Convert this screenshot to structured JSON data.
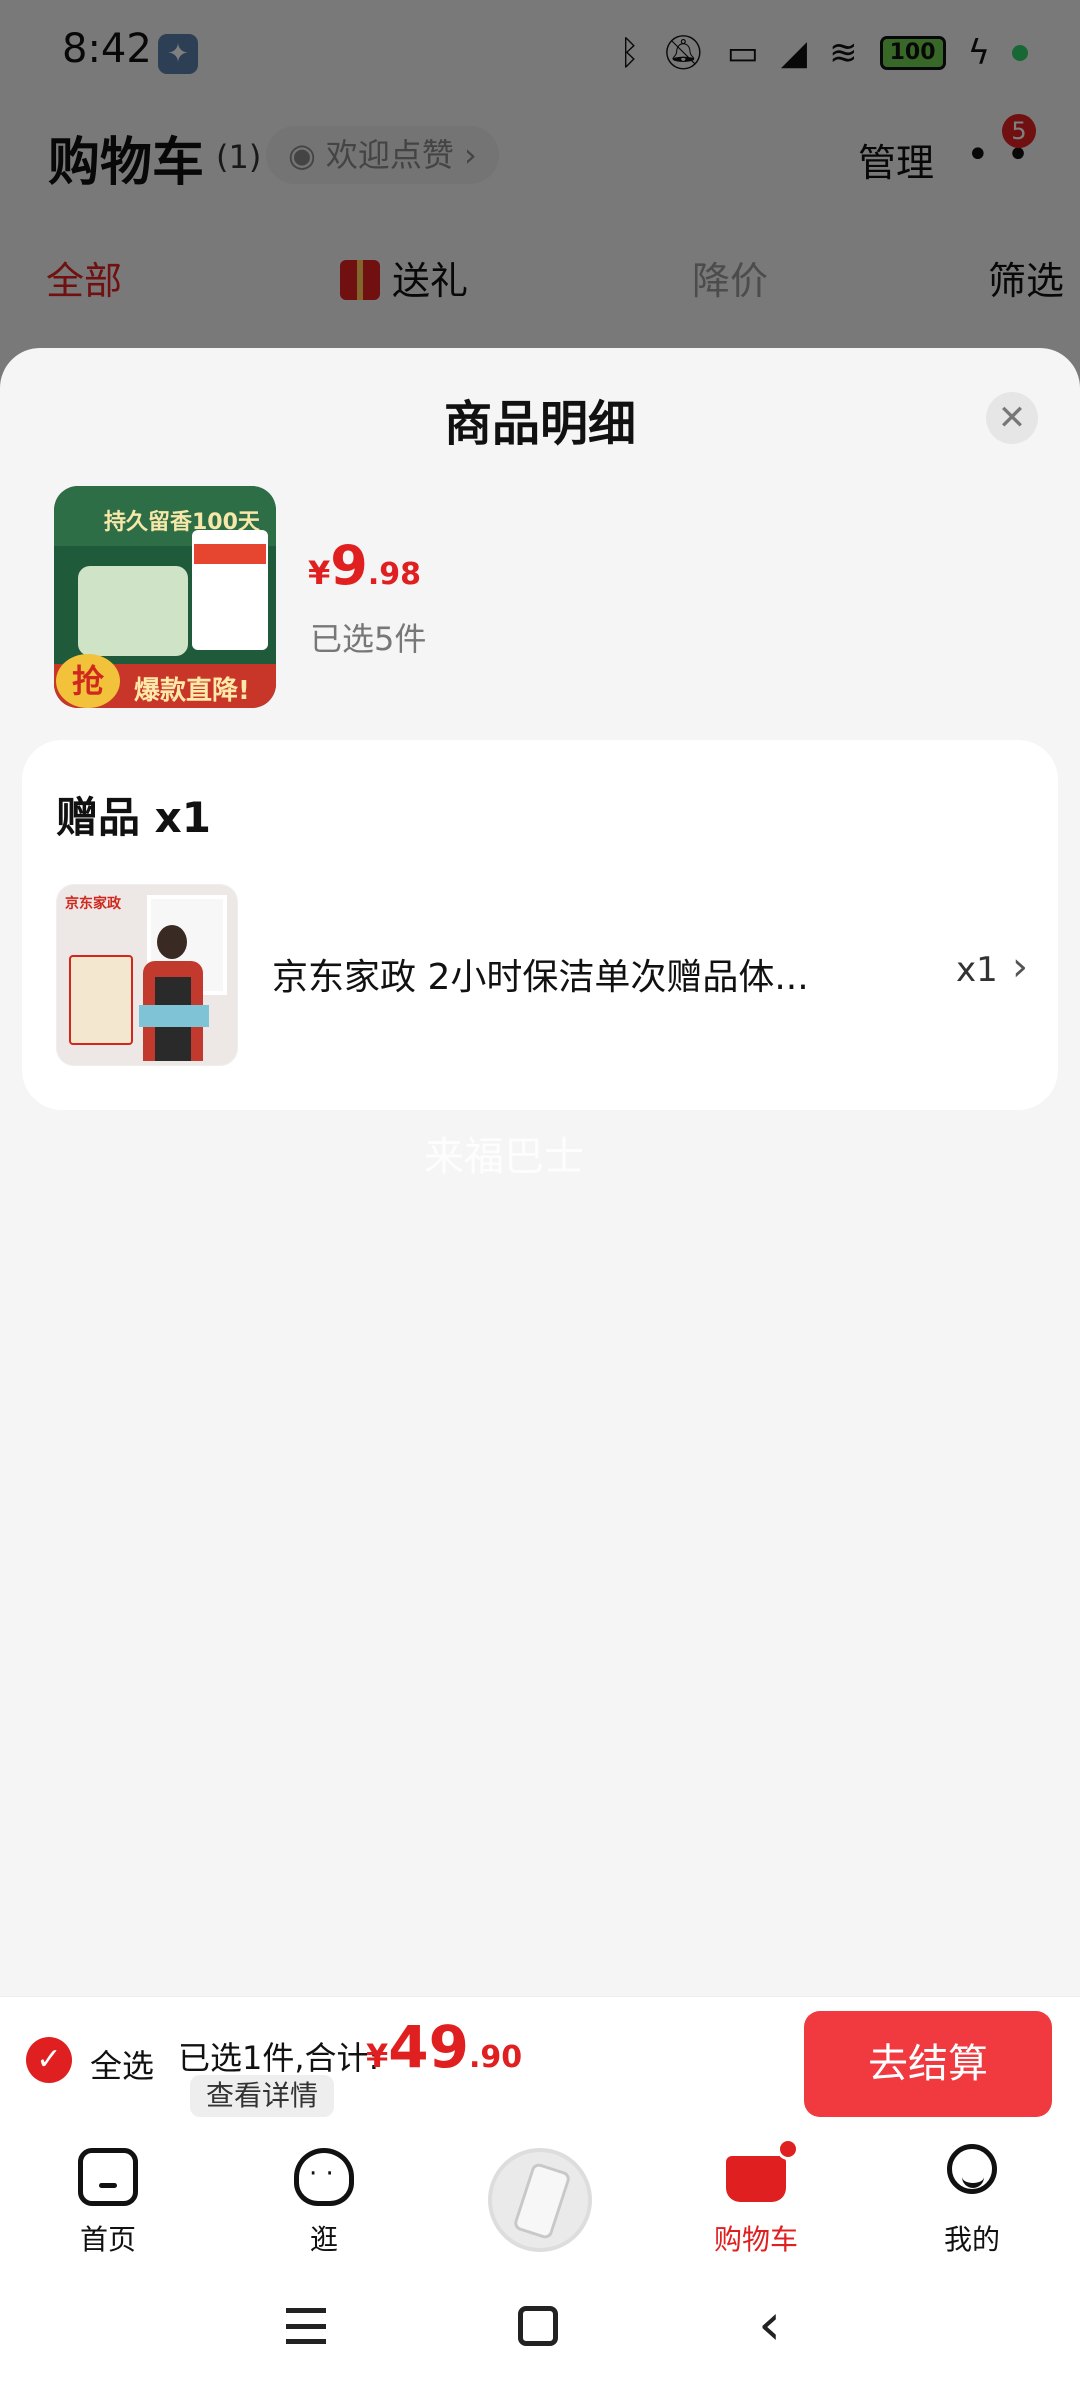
{
  "status_bar": {
    "time": "8:42",
    "tool_icon": "wrench-icon",
    "battery": "100"
  },
  "cart_header": {
    "title": "购物车",
    "count": "(1)",
    "like_text": "欢迎点赞",
    "manage": "管理",
    "more_badge": "5"
  },
  "cart_tabs": {
    "all": "全部",
    "gift": "送礼",
    "price_drop": "降价",
    "filter": "筛选"
  },
  "sheet": {
    "title": "商品明细",
    "close_icon": "close-icon",
    "product": {
      "thumb_title": "持久留香100天",
      "thumb_banner": "爆款直降!",
      "thumb_badge": "抢",
      "price_symbol": "¥",
      "price_int": "9",
      "price_dec": ".98",
      "selected": "已选5件"
    },
    "gift_section": {
      "title": "赠品 x1",
      "thumb_label": "京东家政",
      "item_name": "京东家政 2小时保洁单次赠品体...",
      "qty": "x1"
    },
    "watermark": "来福巴士"
  },
  "checkout": {
    "select_all": "全选",
    "summary": "已选1件,合计:",
    "total_symbol": "¥",
    "total_int": "49",
    "total_dec": ".90",
    "details": "查看详情",
    "checkout_button": "去结算"
  },
  "bottom_nav": {
    "home": "首页",
    "stroll": "逛",
    "cart": "购物车",
    "me": "我的"
  },
  "colors": {
    "accent": "#e02020",
    "checkout_button": "#f03a3f",
    "sheet_bg": "#f5f5f5"
  }
}
